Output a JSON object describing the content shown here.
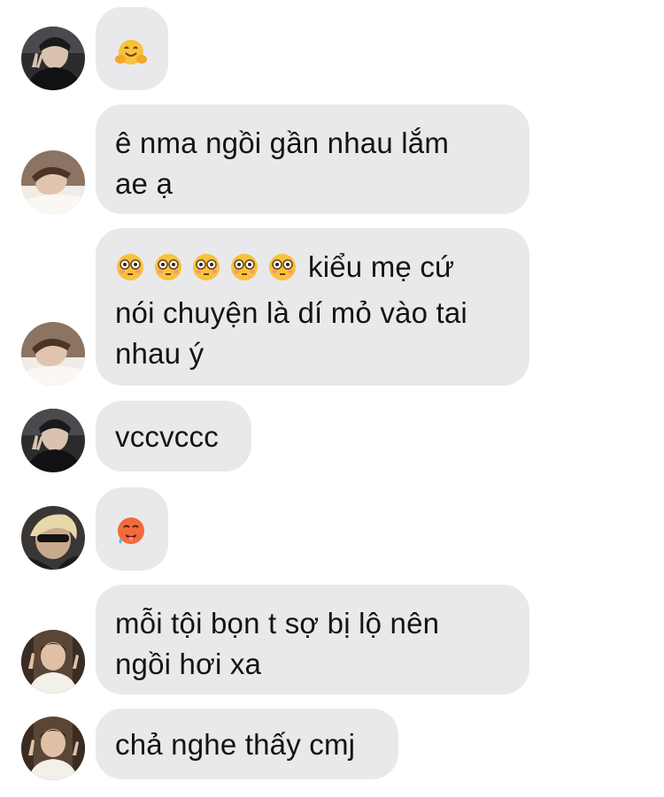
{
  "messages": [
    {
      "id": "m1",
      "sender": "boy-dark-jacket",
      "emoji": "hugging-face-icon",
      "text": ""
    },
    {
      "id": "m2",
      "sender": "boy-pillow",
      "text": "ê nma ngồi gần nhau lắm\nae ạ"
    },
    {
      "id": "m3",
      "sender": "boy-pillow",
      "emoji_prefix": [
        "flushed-face-icon",
        "flushed-face-icon",
        "flushed-face-icon",
        "flushed-face-icon",
        "flushed-face-icon"
      ],
      "text": "kiểu mẹ cứ\nnói chuyện là dí mỏ vào tai\nnhau ý"
    },
    {
      "id": "m4",
      "sender": "boy-dark-jacket",
      "text": "vccvccc"
    },
    {
      "id": "m5",
      "sender": "boy-blonde",
      "emoji": "hot-face-icon",
      "text": ""
    },
    {
      "id": "m6",
      "sender": "boy-white-shirt",
      "text": "mỗi tội bọn t sợ bị lộ nên\nngồi hơi xa"
    },
    {
      "id": "m7",
      "sender": "boy-white-shirt",
      "text": "chả nghe thấy cmj"
    }
  ],
  "colors": {
    "bubble": "#e9e9eb",
    "text": "#141414",
    "background": "#ffffff"
  }
}
